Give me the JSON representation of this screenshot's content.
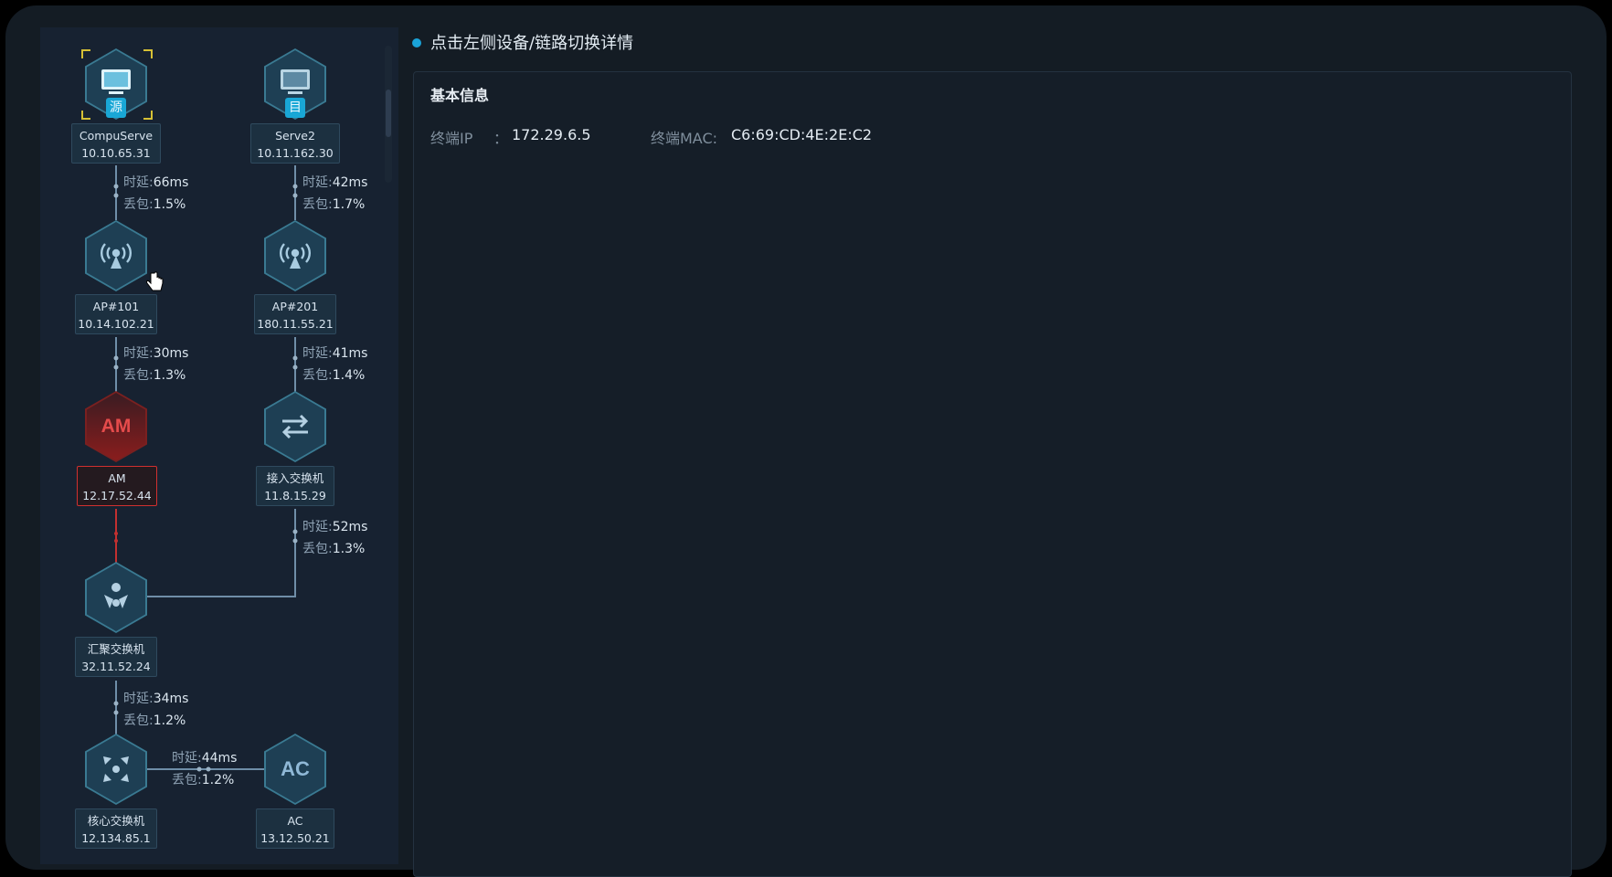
{
  "panel_title": "点击左侧设备/链路切换详情",
  "basic": {
    "section_title": "基本信息",
    "ip_label": "终端IP",
    "ip_sep": "：",
    "ip_value": "172.29.6.5",
    "mac_label": "终端MAC:",
    "mac_value": "C6:69:CD:4E:2E:C2"
  },
  "nodes": {
    "src": {
      "name": "CompuServe",
      "ip": "10.10.65.31",
      "badge": "源",
      "icon": "desktop-icon"
    },
    "dst": {
      "name": "Serve2",
      "ip": "10.11.162.30",
      "badge": "目",
      "icon": "desktop-icon"
    },
    "ap1": {
      "name": "AP#101",
      "ip": "10.14.102.21",
      "icon": "wireless-ap-icon"
    },
    "ap2": {
      "name": "AP#201",
      "ip": "180.11.55.21",
      "icon": "wireless-ap-icon"
    },
    "am": {
      "name": "AM",
      "ip": "12.17.52.44",
      "icon_text": "AM"
    },
    "access": {
      "name": "接入交换机",
      "ip": "11.8.15.29",
      "icon": "switch-arrows-icon"
    },
    "agg": {
      "name": "汇聚交换机",
      "ip": "32.11.52.24",
      "icon": "aggregation-switch-icon"
    },
    "core": {
      "name": "核心交换机",
      "ip": "12.134.85.1",
      "icon": "core-switch-icon"
    },
    "ac": {
      "name": "AC",
      "ip": "13.12.50.21",
      "icon_text": "AC"
    }
  },
  "metric_labels": {
    "delay": "时延:",
    "loss": "丢包:"
  },
  "links": {
    "src_ap1": {
      "delay": "66ms",
      "loss": "1.5%"
    },
    "dst_ap2": {
      "delay": "42ms",
      "loss": "1.7%"
    },
    "ap1_am": {
      "delay": "30ms",
      "loss": "1.3%"
    },
    "ap2_acc": {
      "delay": "41ms",
      "loss": "1.4%"
    },
    "acc_agg": {
      "delay": "52ms",
      "loss": "1.3%"
    },
    "agg_core": {
      "delay": "34ms",
      "loss": "1.2%"
    },
    "core_ac": {
      "delay": "44ms",
      "loss": "1.2%"
    }
  },
  "colors": {
    "accent": "#1aa3d8",
    "alert": "#d03030",
    "link": "#6f8ea8"
  }
}
